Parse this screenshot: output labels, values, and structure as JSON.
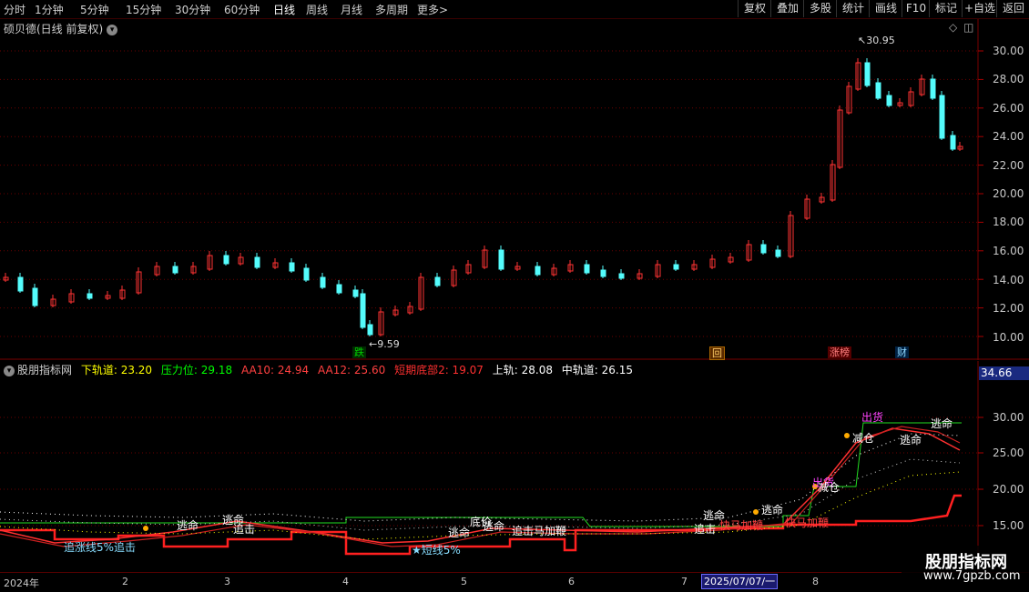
{
  "periods": [
    "分时",
    "1分钟",
    "5分钟",
    "15分钟",
    "30分钟",
    "60分钟",
    "日线",
    "周线",
    "月线",
    "多周期",
    "更多"
  ],
  "active_period": "日线",
  "more_arrow": ">",
  "toolbar": [
    "复权",
    "叠加",
    "多股",
    "统计",
    "画线",
    "F10",
    "标记",
    "+自选",
    "返回"
  ],
  "stock": {
    "title": "硕贝德(日线 前复权)",
    "dropdown_icon": "chevron-down-icon"
  },
  "main_chart": {
    "y_ticks": [
      "30.00",
      "28.00",
      "26.00",
      "24.00",
      "22.00",
      "20.00",
      "18.00",
      "16.00",
      "14.00",
      "12.00",
      "10.00"
    ],
    "high_label": "30.95",
    "low_label": "9.59",
    "markers": [
      {
        "text": "跌",
        "color": "#00c000",
        "bg": "#003300"
      },
      {
        "text": "回",
        "color": "#ffcc66",
        "bg": "#663300"
      },
      {
        "text": "涨榜",
        "color": "#ff8080",
        "bg": "#550000"
      },
      {
        "text": "财",
        "color": "#8fd8ff",
        "bg": "#002244"
      }
    ],
    "colors": {
      "up": "#ff3333",
      "down": "#54fcfc"
    }
  },
  "indicator": {
    "name": "股朋指标网",
    "legend": [
      {
        "label": "下轨道: 23.20",
        "color": "#ffff00"
      },
      {
        "label": "压力位: 29.18",
        "color": "#00ff00"
      },
      {
        "label": "AA10: 24.94",
        "color": "#ff4040"
      },
      {
        "label": "AA12: 25.60",
        "color": "#ff4040"
      },
      {
        "label": "短期底部2: 19.07",
        "color": "#ff3030"
      },
      {
        "label": "上轨: 28.08",
        "color": "#ffffff"
      },
      {
        "label": "中轨道: 26.15",
        "color": "#ffffff"
      }
    ],
    "y_ticks": [
      "30.00",
      "25.00",
      "20.00",
      "15.00"
    ],
    "current_value": "34.66",
    "signals": [
      {
        "text": "出货",
        "color": "#ff44ff"
      },
      {
        "text": "出货",
        "color": "#ff44ff"
      },
      {
        "text": "减仓",
        "color": "#ffffff"
      },
      {
        "text": "减仓",
        "color": "#ffffff"
      },
      {
        "text": "逃命",
        "color": "#ffffff"
      },
      {
        "text": "逃命",
        "color": "#ffffff"
      },
      {
        "text": "逃命",
        "color": "#ffffff"
      },
      {
        "text": "逃命",
        "color": "#ffffff"
      },
      {
        "text": "逃命",
        "color": "#ffffff"
      },
      {
        "text": "逃命",
        "color": "#ffffff"
      },
      {
        "text": "逃命",
        "color": "#ffffff"
      },
      {
        "text": "逃命",
        "color": "#ffffff"
      },
      {
        "text": "追击",
        "color": "#ffffff"
      },
      {
        "text": "追击",
        "color": "#ffffff"
      },
      {
        "text": "追击马加鞭",
        "color": "#ff4040"
      },
      {
        "text": "快马加鞭",
        "color": "#ff4040"
      },
      {
        "text": "快马加鞭",
        "color": "#ff4040"
      },
      {
        "text": "追涨线5%追击",
        "color": "#88ddff"
      },
      {
        "text": "★短线5%",
        "color": "#88ddff"
      },
      {
        "text": "底价",
        "color": "#ffffff"
      }
    ]
  },
  "date_axis": {
    "labels": [
      "2024年",
      "2",
      "3",
      "4",
      "5",
      "6",
      "7",
      "8"
    ],
    "cursor_date": "2025/07/07/一"
  },
  "watermark": {
    "line1": "股朋指标网",
    "line2": "www.7gpzb.com"
  }
}
